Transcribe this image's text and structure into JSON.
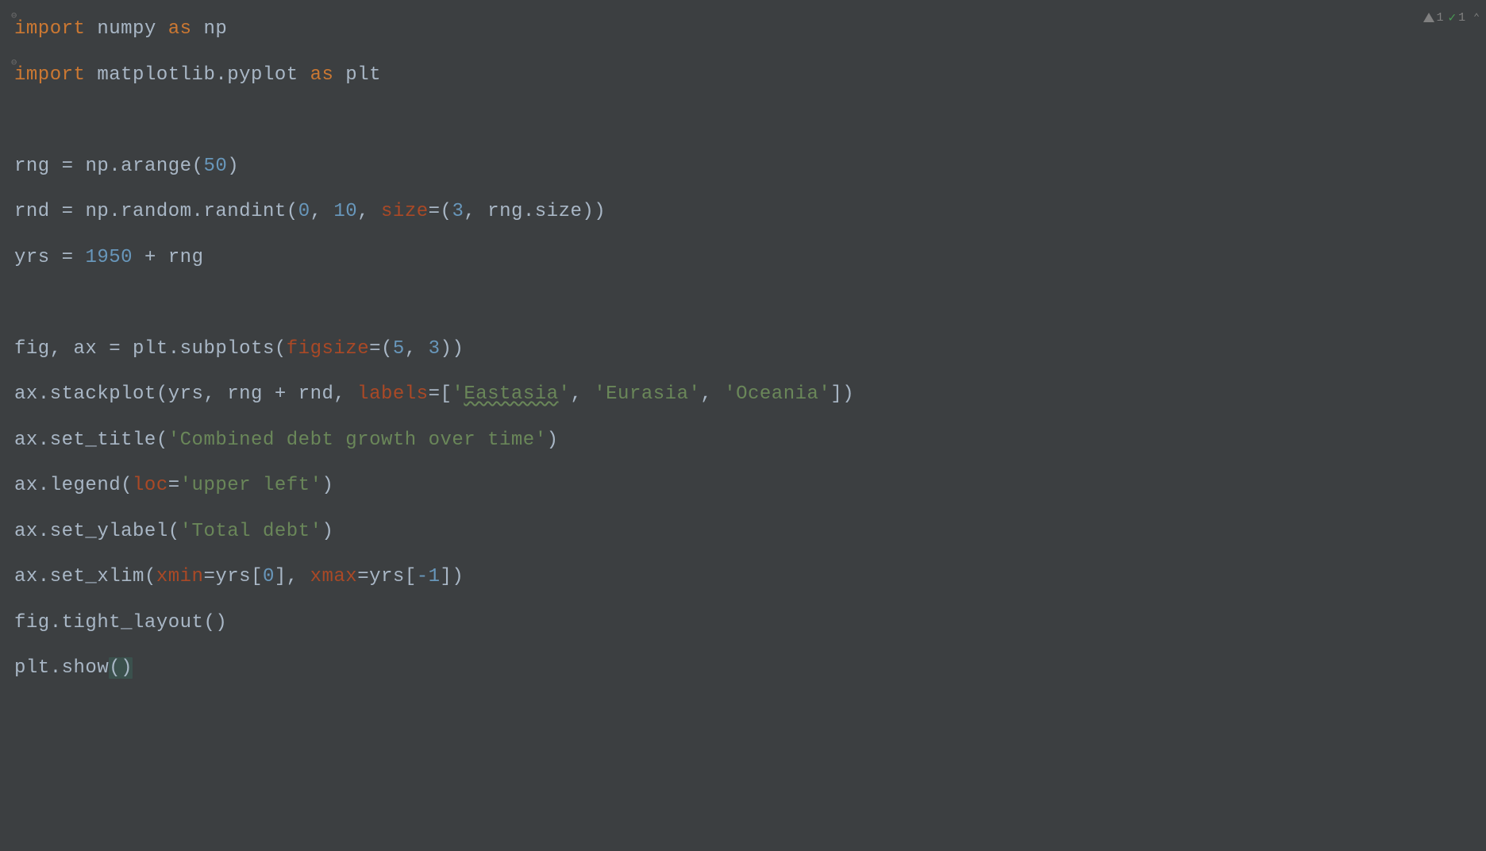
{
  "status": {
    "warnings": "1",
    "checks": "1"
  },
  "code": {
    "l1": {
      "kw1": "import",
      "mod": "numpy",
      "kw2": "as",
      "alias": "np"
    },
    "l2": {
      "kw1": "import",
      "mod": "matplotlib.pyplot",
      "kw2": "as",
      "alias": "plt"
    },
    "l4": {
      "var": "rng",
      "eq": " = ",
      "call": "np.arange",
      "lp": "(",
      "num": "50",
      "rp": ")"
    },
    "l5": {
      "var": "rnd",
      "eq": " = ",
      "call": "np.random.randint",
      "lp": "(",
      "n1": "0",
      "c1": ", ",
      "n2": "10",
      "c2": ", ",
      "kwarg": "size",
      "eq2": "=(",
      "n3": "3",
      "c3": ", ",
      "tail": "rng.size))"
    },
    "l6": {
      "var": "yrs",
      "eq": " = ",
      "num": "1950",
      "plus": " + ",
      "var2": "rng"
    },
    "l8": {
      "lhs": "fig, ax",
      "eq": " = ",
      "call": "plt.subplots",
      "lp": "(",
      "kwarg": "figsize",
      "eq2": "=(",
      "n1": "5",
      "c1": ", ",
      "n2": "3",
      "rp": "))"
    },
    "l9": {
      "call": "ax.stackplot",
      "lp": "(",
      "args": "yrs, rng + rnd, ",
      "kwarg": "labels",
      "eq2": "=[",
      "q1a": "'",
      "s1": "Eastasia",
      "q1b": "'",
      "c1": ", ",
      "s2": "'Eurasia'",
      "c2": ", ",
      "s3": "'Oceania'",
      "rp": "])"
    },
    "l10": {
      "call": "ax.set_title",
      "lp": "(",
      "s": "'Combined debt growth over time'",
      "rp": ")"
    },
    "l11": {
      "call": "ax.legend",
      "lp": "(",
      "kwarg": "loc",
      "eq2": "=",
      "s": "'upper left'",
      "rp": ")"
    },
    "l12": {
      "call": "ax.set_ylabel",
      "lp": "(",
      "s": "'Total debt'",
      "rp": ")"
    },
    "l13": {
      "call": "ax.set_xlim",
      "lp": "(",
      "kwarg1": "xmin",
      "eq1": "=yrs[",
      "n1": "0",
      "mid": "], ",
      "kwarg2": "xmax",
      "eq2": "=yrs[",
      "n2": "-1",
      "rp": "])"
    },
    "l14": {
      "call": "fig.tight_layout",
      "lp": "(",
      "rp": ")"
    },
    "l15": {
      "call": "plt.show",
      "lp": "(",
      "rp": ")"
    }
  }
}
